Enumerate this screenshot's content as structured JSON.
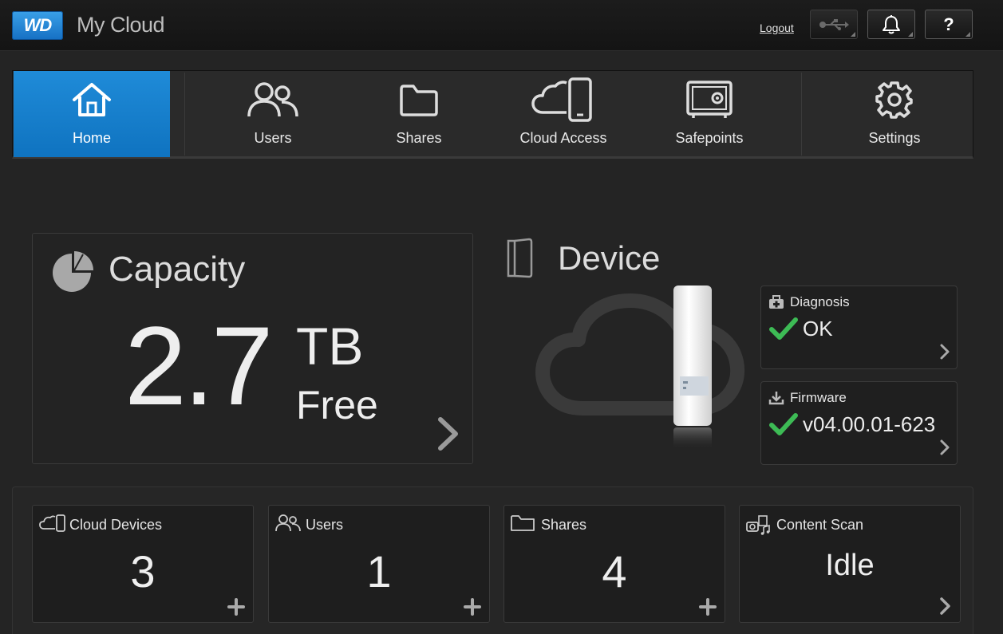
{
  "header": {
    "logo_text": "WD",
    "app_title": "My Cloud",
    "logout_label": "Logout",
    "help_label": "?",
    "icons": [
      "usb-icon",
      "bell-icon"
    ]
  },
  "nav": {
    "items": [
      {
        "label": "Home",
        "icon": "home-icon",
        "active": true
      },
      {
        "label": "Users",
        "icon": "users-icon"
      },
      {
        "label": "Shares",
        "icon": "folder-icon"
      },
      {
        "label": "Cloud Access",
        "icon": "cloud-device-icon"
      },
      {
        "label": "Safepoints",
        "icon": "safe-icon"
      },
      {
        "label": "Settings",
        "icon": "gear-icon"
      }
    ],
    "active_color": "#1784d0"
  },
  "capacity": {
    "title": "Capacity",
    "value": "2.7",
    "unit": "TB",
    "free_label": "Free"
  },
  "device": {
    "title": "Device",
    "diagnosis": {
      "title": "Diagnosis",
      "value": "OK"
    },
    "firmware": {
      "title": "Firmware",
      "value": "v04.00.01-623"
    },
    "ok_color": "#3dbb55"
  },
  "stats": [
    {
      "title": "Cloud Devices",
      "value": "3",
      "icon": "cloud-device-icon",
      "action": "plus-icon"
    },
    {
      "title": "Users",
      "value": "1",
      "icon": "users-icon",
      "action": "plus-icon"
    },
    {
      "title": "Shares",
      "value": "4",
      "icon": "folder-icon",
      "action": "plus-icon"
    },
    {
      "title": "Content Scan",
      "value": "Idle",
      "icon": "media-icon",
      "action": "chevron-right-icon"
    }
  ]
}
